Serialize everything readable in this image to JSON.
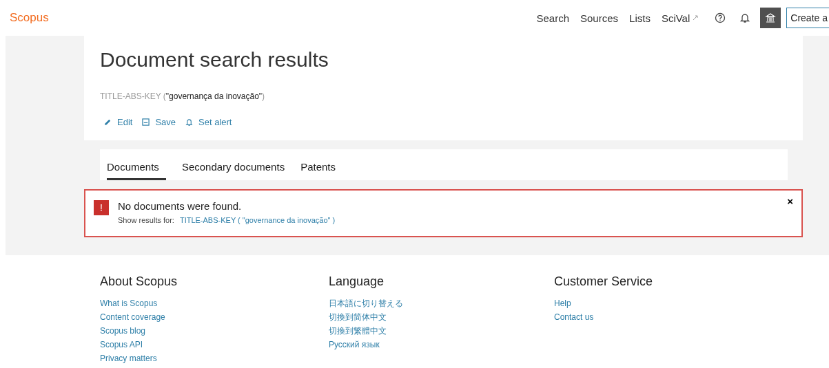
{
  "header": {
    "logo": "Scopus",
    "nav": [
      {
        "label": "Search",
        "external": false
      },
      {
        "label": "Sources",
        "external": false
      },
      {
        "label": "Lists",
        "external": false
      },
      {
        "label": "SciVal",
        "external": true
      }
    ],
    "create_button": "Create a"
  },
  "title": "Document search results",
  "query": {
    "field": "TITLE-ABS-KEY",
    "open": "(",
    "term": "\"governança da inovação\"",
    "close": ")"
  },
  "actions": [
    {
      "kind": "edit",
      "label": "Edit"
    },
    {
      "kind": "save",
      "label": "Save"
    },
    {
      "kind": "alert",
      "label": "Set alert"
    }
  ],
  "tabs": [
    {
      "label": "Documents",
      "selected": true
    },
    {
      "label": "Secondary documents",
      "selected": false
    },
    {
      "label": "Patents",
      "selected": false
    }
  ],
  "alert": {
    "icon": "!",
    "message": "No documents were found.",
    "hint": "Show results for:",
    "link": "TITLE-ABS-KEY ( \"governance da inovação\" )",
    "close": "×"
  },
  "footer": [
    {
      "heading": "About Scopus",
      "links": [
        "What is Scopus",
        "Content coverage",
        "Scopus blog",
        "Scopus API",
        "Privacy matters"
      ]
    },
    {
      "heading": "Language",
      "links": [
        "日本語に切り替える",
        "切換到简体中文",
        "切換到繁體中文",
        "Русский язык"
      ]
    },
    {
      "heading": "Customer Service",
      "links": [
        "Help",
        "Contact us"
      ]
    }
  ]
}
